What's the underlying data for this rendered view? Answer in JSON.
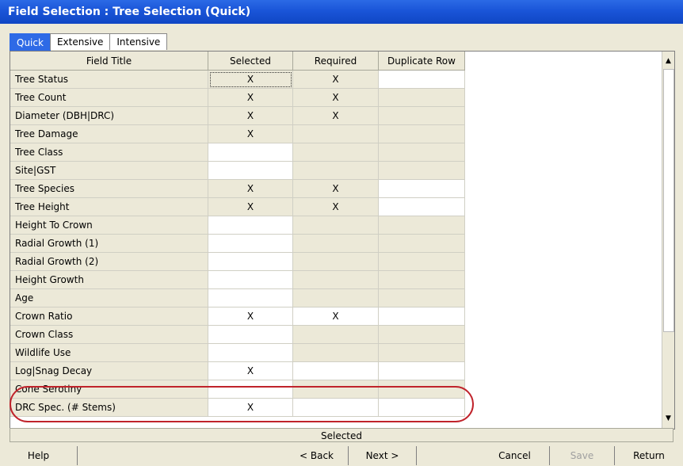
{
  "window": {
    "title": "Field Selection : Tree Selection (Quick)"
  },
  "tabs": [
    {
      "label": "Quick",
      "active": true
    },
    {
      "label": "Extensive",
      "active": false
    },
    {
      "label": "Intensive",
      "active": false
    }
  ],
  "columns": [
    "Field Title",
    "Selected",
    "Required",
    "Duplicate Row"
  ],
  "rows": [
    {
      "title": "Tree Status",
      "selected": "X",
      "required": "X",
      "duplicate": ""
    },
    {
      "title": "Tree Count",
      "selected": "X",
      "required": "X",
      "duplicate": ""
    },
    {
      "title": "Diameter (DBH|DRC)",
      "selected": "X",
      "required": "X",
      "duplicate": ""
    },
    {
      "title": "Tree Damage",
      "selected": "X",
      "required": "",
      "duplicate": ""
    },
    {
      "title": "Tree Class",
      "selected": "",
      "required": "",
      "duplicate": ""
    },
    {
      "title": "Site|GST",
      "selected": "",
      "required": "",
      "duplicate": ""
    },
    {
      "title": "Tree Species",
      "selected": "X",
      "required": "X",
      "duplicate": ""
    },
    {
      "title": "Tree Height",
      "selected": "X",
      "required": "X",
      "duplicate": ""
    },
    {
      "title": "Height To Crown",
      "selected": "",
      "required": "",
      "duplicate": ""
    },
    {
      "title": "Radial Growth (1)",
      "selected": "",
      "required": "",
      "duplicate": ""
    },
    {
      "title": "Radial Growth (2)",
      "selected": "",
      "required": "",
      "duplicate": ""
    },
    {
      "title": "Height Growth",
      "selected": "",
      "required": "",
      "duplicate": ""
    },
    {
      "title": "Age",
      "selected": "",
      "required": "",
      "duplicate": ""
    },
    {
      "title": "Crown Ratio",
      "selected": "X",
      "required": "X",
      "duplicate": ""
    },
    {
      "title": "Crown Class",
      "selected": "",
      "required": "",
      "duplicate": ""
    },
    {
      "title": "Wildlife Use",
      "selected": "",
      "required": "",
      "duplicate": ""
    },
    {
      "title": "Log|Snag Decay",
      "selected": "X",
      "required": "",
      "duplicate": ""
    },
    {
      "title": "Cone Serotiny",
      "selected": "",
      "required": "",
      "duplicate": ""
    },
    {
      "title": "DRC Spec. (# Stems)",
      "selected": "X",
      "required": "",
      "duplicate": ""
    }
  ],
  "cell_shading": [
    [
      "shade",
      "shade",
      "white"
    ],
    [
      "shade",
      "shade",
      "shade"
    ],
    [
      "shade",
      "shade",
      "shade"
    ],
    [
      "shade",
      "shade",
      "shade"
    ],
    [
      "white",
      "shade",
      "shade"
    ],
    [
      "white",
      "shade",
      "shade"
    ],
    [
      "shade",
      "shade",
      "white"
    ],
    [
      "shade",
      "shade",
      "white"
    ],
    [
      "white",
      "shade",
      "shade"
    ],
    [
      "white",
      "shade",
      "shade"
    ],
    [
      "white",
      "shade",
      "shade"
    ],
    [
      "white",
      "shade",
      "shade"
    ],
    [
      "white",
      "shade",
      "shade"
    ],
    [
      "white",
      "white",
      "white"
    ],
    [
      "white",
      "shade",
      "shade"
    ],
    [
      "white",
      "shade",
      "shade"
    ],
    [
      "white",
      "white",
      "white"
    ],
    [
      "white",
      "shade",
      "shade"
    ],
    [
      "white",
      "white",
      "white"
    ]
  ],
  "status_text": "Selected",
  "buttons": {
    "help": "Help",
    "back": "< Back",
    "next": "Next >",
    "cancel": "Cancel",
    "save": "Save",
    "return": "Return"
  },
  "icons": {
    "scroll_up": "scroll-up-arrow-icon",
    "scroll_down": "scroll-down-arrow-icon"
  },
  "colors": {
    "title_bar": "#1a55d8",
    "active_tab": "#2e6ae6",
    "highlight_oval": "#c0232b",
    "dialog_bg": "#ece9d8"
  }
}
